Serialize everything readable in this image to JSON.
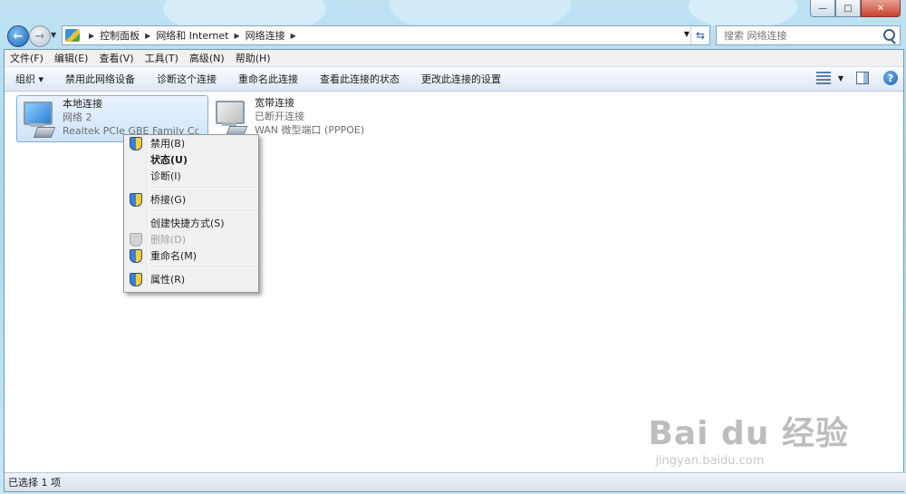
{
  "title_bar": {
    "buttons": [
      "minimize",
      "maximize",
      "close"
    ],
    "button_glyphs": {
      "minimize": "—",
      "maximize": "□",
      "close": "✕"
    }
  },
  "navigation": {
    "back_glyph": "←",
    "forward_glyph": "→",
    "breadcrumbs": [
      "控制面板",
      "网络和 Internet",
      "网络连接"
    ],
    "refresh_glyph": "⇆",
    "search_placeholder": "搜索 网络连接"
  },
  "menubar": [
    "文件(F)",
    "编辑(E)",
    "查看(V)",
    "工具(T)",
    "高级(N)",
    "帮助(H)"
  ],
  "commandbar": {
    "organize": "组织 ▾",
    "actions": [
      "禁用此网络设备",
      "诊断这个连接",
      "重命名此连接",
      "查看此连接的状态",
      "更改此连接的设置"
    ],
    "help_glyph": "?"
  },
  "connections": [
    {
      "name": "本地连接",
      "network": "网络  2",
      "device": "Realtek PCIe GBE Family Contr",
      "selected": true
    },
    {
      "name": "宽带连接",
      "network": "已断开连接",
      "device": "WAN 微型端口 (PPPOE)",
      "selected": false
    }
  ],
  "context_menu": {
    "groups": [
      [
        {
          "label": "禁用(B)",
          "shield": true,
          "bold": false,
          "disabled": false
        },
        {
          "label": "状态(U)",
          "shield": false,
          "bold": true,
          "disabled": false
        },
        {
          "label": "诊断(I)",
          "shield": false,
          "bold": false,
          "disabled": false
        }
      ],
      [
        {
          "label": "桥接(G)",
          "shield": true,
          "bold": false,
          "disabled": false
        }
      ],
      [
        {
          "label": "创建快捷方式(S)",
          "shield": false,
          "bold": false,
          "disabled": false
        },
        {
          "label": "删除(D)",
          "shield": true,
          "bold": false,
          "disabled": true
        },
        {
          "label": "重命名(M)",
          "shield": true,
          "bold": false,
          "disabled": false
        }
      ],
      [
        {
          "label": "属性(R)",
          "shield": true,
          "bold": false,
          "disabled": false
        }
      ]
    ]
  },
  "statusbar": {
    "text": "已选择 1 项"
  },
  "watermark": {
    "logo": "Bai du 经验",
    "url": "jingyan.baidu.com"
  }
}
